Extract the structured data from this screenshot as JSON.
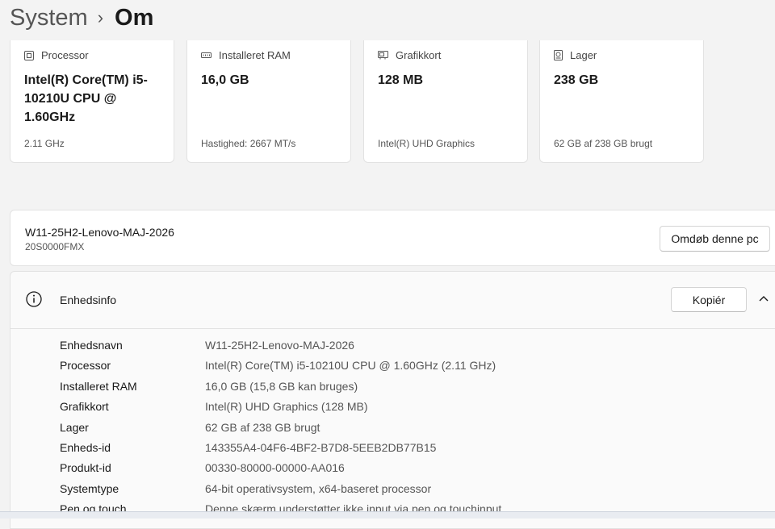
{
  "breadcrumb": {
    "parent": "System",
    "separator": "›",
    "current": "Om"
  },
  "cards": [
    {
      "icon": "processor-icon",
      "label": "Processor",
      "value": "Intel(R) Core(TM) i5-10210U CPU @ 1.60GHz",
      "sub": "2.11 GHz"
    },
    {
      "icon": "ram-icon",
      "label": "Installeret RAM",
      "value": "16,0 GB",
      "sub": "Hastighed: 2667 MT/s"
    },
    {
      "icon": "graphics-card-icon",
      "label": "Grafikkort",
      "value": "128 MB",
      "sub": "Intel(R) UHD Graphics"
    },
    {
      "icon": "storage-icon",
      "label": "Lager",
      "value": "238 GB",
      "sub": "62 GB af 238 GB brugt"
    }
  ],
  "pc": {
    "name": "W11-25H2-Lenovo-MAJ-2026",
    "model": "20S0000FMX",
    "rename_label": "Omdøb denne pc"
  },
  "device_info": {
    "title": "Enhedsinfo",
    "copy_label": "Kopiér",
    "rows": [
      {
        "label": "Enhedsnavn",
        "value": "W11-25H2-Lenovo-MAJ-2026"
      },
      {
        "label": "Processor",
        "value": "Intel(R) Core(TM) i5-10210U CPU @ 1.60GHz (2.11 GHz)"
      },
      {
        "label": "Installeret RAM",
        "value": "16,0 GB (15,8 GB kan bruges)"
      },
      {
        "label": "Grafikkort",
        "value": "Intel(R) UHD Graphics (128 MB)"
      },
      {
        "label": "Lager",
        "value": "62 GB af 238 GB brugt"
      },
      {
        "label": "Enheds-id",
        "value": "143355A4-04F6-4BF2-B7D8-5EEB2DB77B15"
      },
      {
        "label": "Produkt-id",
        "value": "00330-80000-00000-AA016"
      },
      {
        "label": "Systemtype",
        "value": "64-bit operativsystem, x64-baseret processor"
      },
      {
        "label": "Pen og touch",
        "value": "Denne skærm understøtter ikke input via pen og touchinput"
      }
    ]
  },
  "colors": {
    "background": "#f3f3f3",
    "card": "#ffffff",
    "border": "#e2e2e2",
    "secondary_text": "#555555"
  }
}
